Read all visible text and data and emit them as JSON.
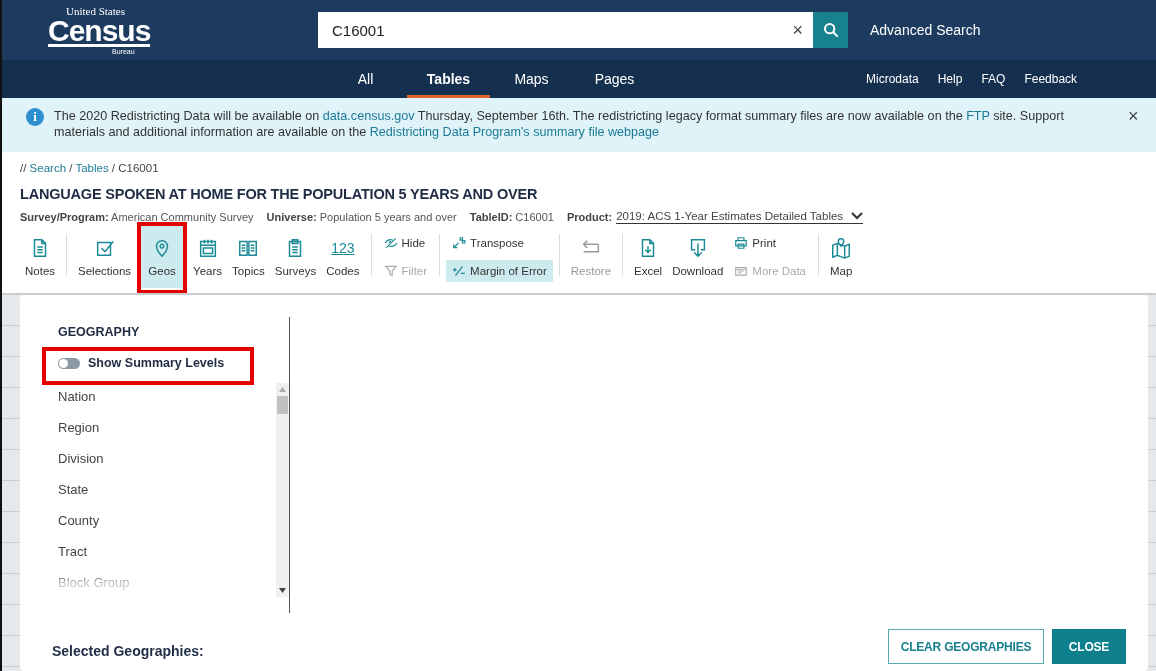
{
  "logo": {
    "top": "United States",
    "main": "Census",
    "bottom": "Bureau"
  },
  "search": {
    "value": "C16001",
    "clear": "×",
    "advanced": "Advanced Search"
  },
  "nav": {
    "tabs": [
      {
        "label": "All",
        "selected": false
      },
      {
        "label": "Tables",
        "selected": true
      },
      {
        "label": "Maps",
        "selected": false
      },
      {
        "label": "Pages",
        "selected": false
      }
    ],
    "links": [
      "Microdata",
      "Help",
      "FAQ",
      "Feedback"
    ]
  },
  "banner": {
    "icon": "i",
    "close": "×",
    "segments": [
      {
        "text": "The 2020 Redistricting Data will be available on ",
        "kind": "text"
      },
      {
        "text": "data.census.gov",
        "kind": "link"
      },
      {
        "text": " Thursday, September 16th. The redistricting legacy format summary files are now available on the ",
        "kind": "text"
      },
      {
        "text": "FTP",
        "kind": "link"
      },
      {
        "text": " site. Support materials and additional information are available on the ",
        "kind": "text"
      },
      {
        "text": "Redistricting Data Program's summary file webpage",
        "kind": "link"
      }
    ]
  },
  "breadcrumb": [
    {
      "text": "// ",
      "kind": "text"
    },
    {
      "text": "Search",
      "kind": "link"
    },
    {
      "text": " / ",
      "kind": "text"
    },
    {
      "text": "Tables",
      "kind": "link"
    },
    {
      "text": " / C16001",
      "kind": "text"
    }
  ],
  "title": "LANGUAGE SPOKEN AT HOME FOR THE POPULATION 5 YEARS AND OVER",
  "meta": [
    "**Survey/Program:** American Community Survey",
    "**Universe:** Population 5 years and over",
    "**TableID:** C16001"
  ],
  "product": {
    "label": "Product:",
    "value": "2019: ACS 1-Year Estimates Detailed Tables"
  },
  "toolbar": {
    "groups": [
      [
        {
          "kind": "tool",
          "label": "Notes",
          "selected": false,
          "disabled": false,
          "highlighted": false
        }
      ],
      [
        {
          "kind": "tool",
          "label": "Selections",
          "selected": false,
          "disabled": false,
          "highlighted": false
        },
        {
          "kind": "tool",
          "label": "Geos",
          "selected": true,
          "disabled": false,
          "highlighted": true
        },
        {
          "kind": "tool",
          "label": "Years",
          "selected": false,
          "disabled": false,
          "highlighted": false
        },
        {
          "kind": "tool",
          "label": "Topics",
          "selected": false,
          "disabled": false,
          "highlighted": false
        },
        {
          "kind": "tool",
          "label": "Surveys",
          "selected": false,
          "disabled": false,
          "highlighted": false
        },
        {
          "kind": "tool",
          "label": "Codes",
          "icon_text": "123",
          "selected": false,
          "disabled": false,
          "highlighted": false
        }
      ],
      [
        {
          "kind": "pair",
          "top": {
            "label": "Hide",
            "selected": false,
            "disabled": false
          },
          "bottom": {
            "label": "Filter",
            "selected": false,
            "disabled": true
          }
        }
      ],
      [
        {
          "kind": "pair",
          "top": {
            "label": "Transpose",
            "selected": false,
            "disabled": false
          },
          "bottom": {
            "label": "Margin of Error",
            "selected": true,
            "disabled": false
          }
        }
      ],
      [
        {
          "kind": "tool",
          "label": "Restore",
          "selected": false,
          "disabled": true,
          "highlighted": false
        }
      ],
      [
        {
          "kind": "tool",
          "label": "Excel",
          "selected": false,
          "disabled": false,
          "highlighted": false
        },
        {
          "kind": "tool",
          "label": "Download",
          "selected": false,
          "disabled": false,
          "highlighted": false
        },
        {
          "kind": "pair",
          "top": {
            "label": "Print",
            "selected": false,
            "disabled": false
          },
          "bottom": {
            "label": "More Data",
            "selected": false,
            "disabled": true
          }
        }
      ],
      [
        {
          "kind": "tool",
          "label": "Map",
          "selected": false,
          "disabled": false,
          "highlighted": false
        }
      ]
    ]
  },
  "geo_panel": {
    "heading": "GEOGRAPHY",
    "toggle": {
      "label": "Show Summary Levels",
      "on": false,
      "highlighted": true
    },
    "levels": [
      "Nation",
      "Region",
      "Division",
      "State",
      "County",
      "Tract",
      "Block Group"
    ],
    "selected_heading": "Selected Geographies:",
    "buttons": [
      {
        "label": "CLEAR GEOGRAPHIES",
        "kind": "outline"
      },
      {
        "label": "CLOSE",
        "kind": "primary"
      }
    ]
  }
}
